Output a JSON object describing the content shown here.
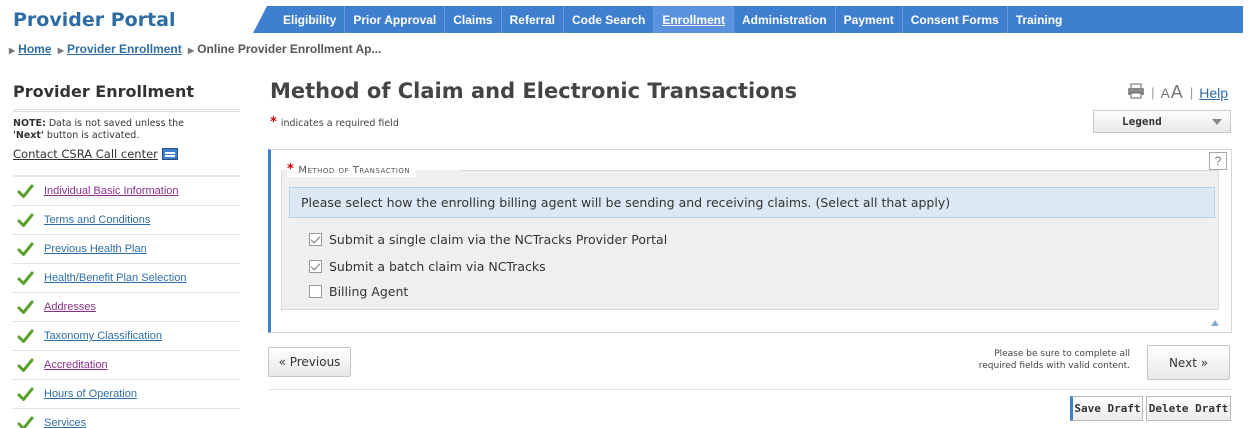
{
  "header": {
    "portal_title": "Provider Portal",
    "nav": [
      {
        "label": "Eligibility"
      },
      {
        "label": "Prior Approval"
      },
      {
        "label": "Claims"
      },
      {
        "label": "Referral"
      },
      {
        "label": "Code Search"
      },
      {
        "label": "Enrollment",
        "active": true
      },
      {
        "label": "Administration"
      },
      {
        "label": "Payment"
      },
      {
        "label": "Consent Forms"
      },
      {
        "label": "Training"
      }
    ],
    "accent_color": "#3f7fcf"
  },
  "breadcrumb": {
    "items": [
      "Home",
      "Provider Enrollment",
      "Online Provider Enrollment Ap..."
    ]
  },
  "sidebar": {
    "title": "Provider Enrollment",
    "note_bold": "NOTE:",
    "note_text1": " Data is not saved unless the",
    "note_next": "'Next'",
    "note_text2": " button is activated.",
    "contact_label": "Contact CSRA Call center",
    "items": [
      {
        "label": "Individual Basic Information",
        "visited": true
      },
      {
        "label": "Terms and Conditions"
      },
      {
        "label": "Previous Health Plan"
      },
      {
        "label": "Health/Benefit Plan Selection"
      },
      {
        "label": "Addresses",
        "visited": true
      },
      {
        "label": "Taxonomy Classification"
      },
      {
        "label": "Accreditation",
        "visited": true
      },
      {
        "label": "Hours of Operation"
      },
      {
        "label": "Services"
      }
    ]
  },
  "main": {
    "title": "Method of Claim and Electronic Transactions",
    "tools": {
      "font_small": "A",
      "font_large": "A",
      "help": "Help",
      "separator": "|"
    },
    "required_star": "*",
    "required_text": "indicates a required field",
    "legend_label": "Legend",
    "section": {
      "legend": "Method of Transaction",
      "help": "?",
      "instructions": "Please select how the enrolling billing agent will be sending and receiving claims. (Select all that apply)",
      "options": [
        {
          "label": "Submit a single claim via the NCTracks Provider Portal",
          "checked": true
        },
        {
          "label": "Submit a batch claim via NCTracks",
          "checked": true
        },
        {
          "label": "Billing Agent",
          "checked": false
        }
      ]
    },
    "previous_label": "« Previous",
    "next_label": "Next »",
    "complete_note_line1": "Please be sure to complete all",
    "complete_note_line2": "required fields with valid content.",
    "save_draft": "Save Draft",
    "delete_draft": "Delete Draft"
  }
}
